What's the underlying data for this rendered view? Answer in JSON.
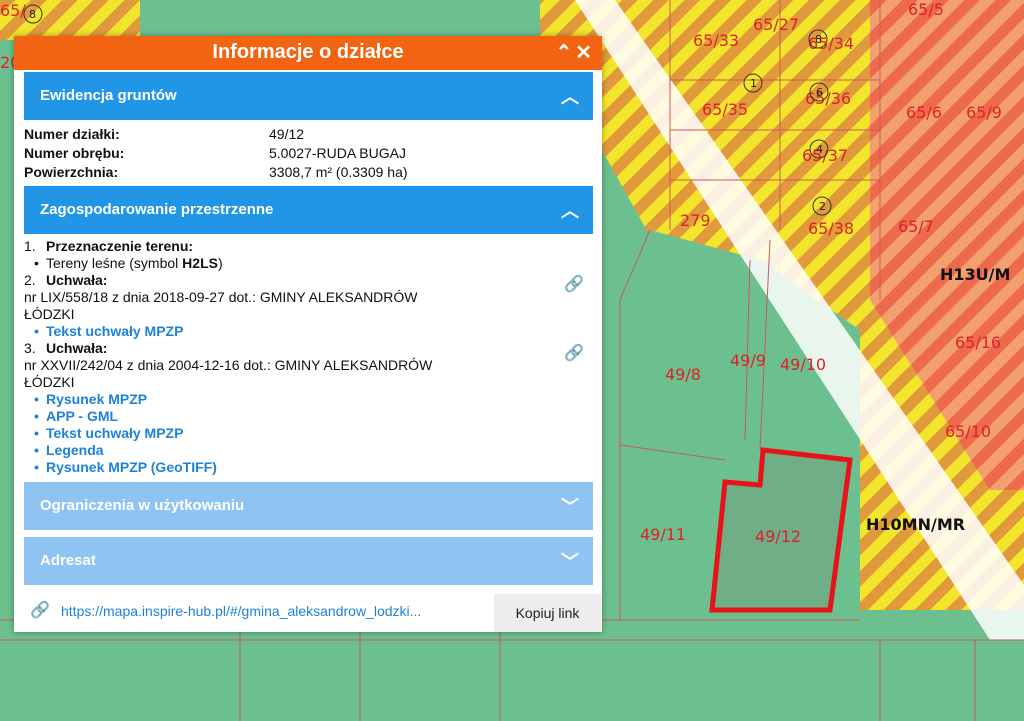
{
  "panel": {
    "title": "Informacje o działce",
    "actions": {
      "collapse": "⌃",
      "close": "✕"
    }
  },
  "sections": {
    "ewidencja": {
      "title": "Ewidencja gruntów",
      "expanded": true,
      "rows": [
        {
          "label": "Numer działki:",
          "value": "49/12"
        },
        {
          "label": "Numer obrębu:",
          "value": "5.0027-RUDA BUGAJ"
        },
        {
          "label": "Powierzchnia:",
          "value": "3308,7 m² (0.3309 ha)"
        }
      ]
    },
    "zagospodarowanie": {
      "title": "Zagospodarowanie przestrzenne",
      "expanded": true,
      "items": [
        {
          "num": "1.",
          "heading": "Przeznaczenie terenu:",
          "bullet_text": "Tereny leśne (symbol ",
          "bullet_symbol": "H2LS",
          "bullet_end": ")"
        },
        {
          "num": "2.",
          "heading": "Uchwała:",
          "text1": "nr LIX/558/18 z dnia 2018-09-27 dot.: GMINY ALEKSANDRÓW",
          "text2": "ŁÓDZKI",
          "links": [
            "Tekst uchwały MPZP"
          ]
        },
        {
          "num": "3.",
          "heading": "Uchwała:",
          "text1": "nr XXVII/242/04 z dnia 2004-12-16 dot.: GMINY ALEKSANDRÓW",
          "text2": "ŁÓDZKI",
          "links": [
            "Rysunek MPZP",
            "APP - GML",
            "Tekst uchwały MPZP",
            "Legenda",
            "Rysunek MPZP (GeoTIFF)"
          ]
        }
      ]
    },
    "ograniczenia": {
      "title": "Ograniczenia w użytkowaniu",
      "expanded": false
    },
    "adresat": {
      "title": "Adresat",
      "expanded": false
    }
  },
  "footer": {
    "url": "https://mapa.inspire-hub.pl/#/gmina_aleksandrow_lodzki...",
    "copy_label": "Kopiuj link"
  },
  "map": {
    "parcels": {
      "p1": "65/33",
      "p2": "65/27",
      "p3": "65/34",
      "p4": "65/35",
      "p5": "65/36",
      "p6": "65/37",
      "p7": "65/38",
      "p8": "279",
      "p9": "65/5",
      "p10": "65/6",
      "p11": "65/9",
      "p12": "65/7",
      "p13": "65/16",
      "p14": "65/10",
      "p15": "49/8",
      "p16": "49/9",
      "p17": "49/10",
      "p18": "49/11",
      "p19": "49/12",
      "p20": "65/",
      "p21": "8",
      "p22": "20"
    },
    "zones": {
      "z1": "H13U/M",
      "z2": "H10MN/MR"
    },
    "circle_numbers": {
      "c1": "1",
      "c2": "8",
      "c3": "6",
      "c4": "4",
      "c5": "2",
      "c6": "8"
    },
    "colors": {
      "forest": "#6cc08f",
      "hatch_yellow": "#f3e52b",
      "hatch_orange": "#e09a3c",
      "hatch_red": "#ee7a5c",
      "selection": "#e8121b",
      "accent_header": "#f26411",
      "section_blue": "#2296e6",
      "section_light": "#8fc4f2"
    }
  }
}
